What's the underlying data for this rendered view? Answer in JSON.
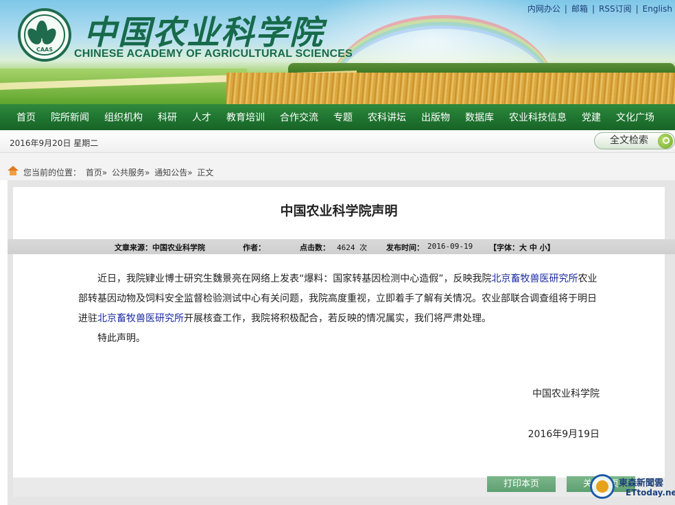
{
  "header": {
    "logo_cn": "中国农业科学院",
    "logo_en": "CHINESE ACADEMY OF AGRICULTURAL SCIENCES",
    "logo_emblem_text": "CAAS",
    "toplinks": [
      "内网办公",
      "邮箱",
      "RSS订阅",
      "English"
    ]
  },
  "nav": {
    "items": [
      "首页",
      "院所新闻",
      "组织机构",
      "科研",
      "人才",
      "教育培训",
      "合作交流",
      "专题",
      "农科讲坛",
      "出版物",
      "数据库",
      "农业科技信息",
      "党建",
      "文化广场"
    ]
  },
  "datebar": {
    "date": "2016年9月20日  星期二",
    "search_label": "全文检索"
  },
  "breadcrumb": {
    "prefix": "您当前的位置：",
    "items": [
      "首页»",
      "公共服务»",
      "通知公告»",
      "正文"
    ]
  },
  "article": {
    "title": "中国农业科学院声明",
    "meta": {
      "source_label": "文章来源：中国农业科学院",
      "author_label": "作者：",
      "clicks_label": "点击数：",
      "clicks_value": "4624 次",
      "time_label": "发布时间：",
      "time_value": "2016-09-19",
      "font_label": "【字体：大 中 小】"
    },
    "para1_a": "近日，我院肄业博士研究生魏景亮在网络上发表“爆料：国家转基因检测中心造假”，反映我院",
    "link1": "北京畜牧兽医研究所",
    "para1_b": "农业部转基因动物及饲料安全监督检验测试中心有关问题，我院高度重视，立即着手了解有关情况。农业部联合调查组将于明日进驻",
    "link2": "北京畜牧兽医研究所",
    "para1_c": "开展核查工作，我院将积极配合，若反映的情况属实，我们将严肃处理。",
    "para2": "特此声明。",
    "signature": "中国农业科学院",
    "sign_date": "2016年9月19日"
  },
  "buttons": {
    "print": "打印本页",
    "close": "关闭本页"
  },
  "watermark": {
    "line1": "東森新聞雲",
    "line2": "ETtoday.net"
  }
}
